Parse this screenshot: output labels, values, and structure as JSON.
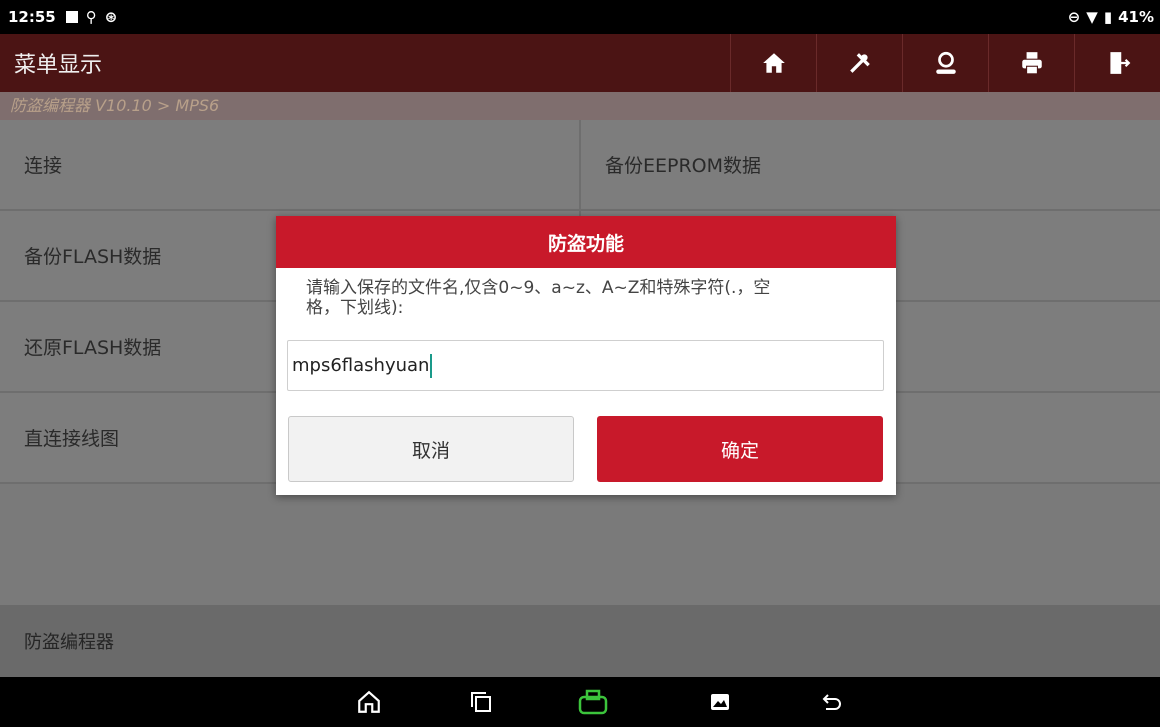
{
  "status_bar": {
    "time": "12:55",
    "battery": "41%"
  },
  "header": {
    "title": "菜单显示"
  },
  "toolbar": {
    "icons": [
      "home-icon",
      "tools-icon",
      "user-icon",
      "print-icon",
      "exit-icon"
    ]
  },
  "breadcrumb": "防盗编程器 V10.10 > MPS6",
  "menu": {
    "items": [
      "连接",
      "备份EEPROM数据",
      "备份FLASH数据",
      "",
      "还原FLASH数据",
      "",
      "直连接线图",
      ""
    ]
  },
  "footer": {
    "label": "防盗编程器"
  },
  "dialog": {
    "title": "防盗功能",
    "message_line1": "请输入保存的文件名,仅含0~9、a~z、A~Z和特殊字符(.，空",
    "message_line2": "格，下划线):",
    "input_value": "mps6flashyuan",
    "cancel_label": "取消",
    "ok_label": "确定"
  },
  "colors": {
    "accent": "#c8192a",
    "header_bg": "#4b1414"
  }
}
